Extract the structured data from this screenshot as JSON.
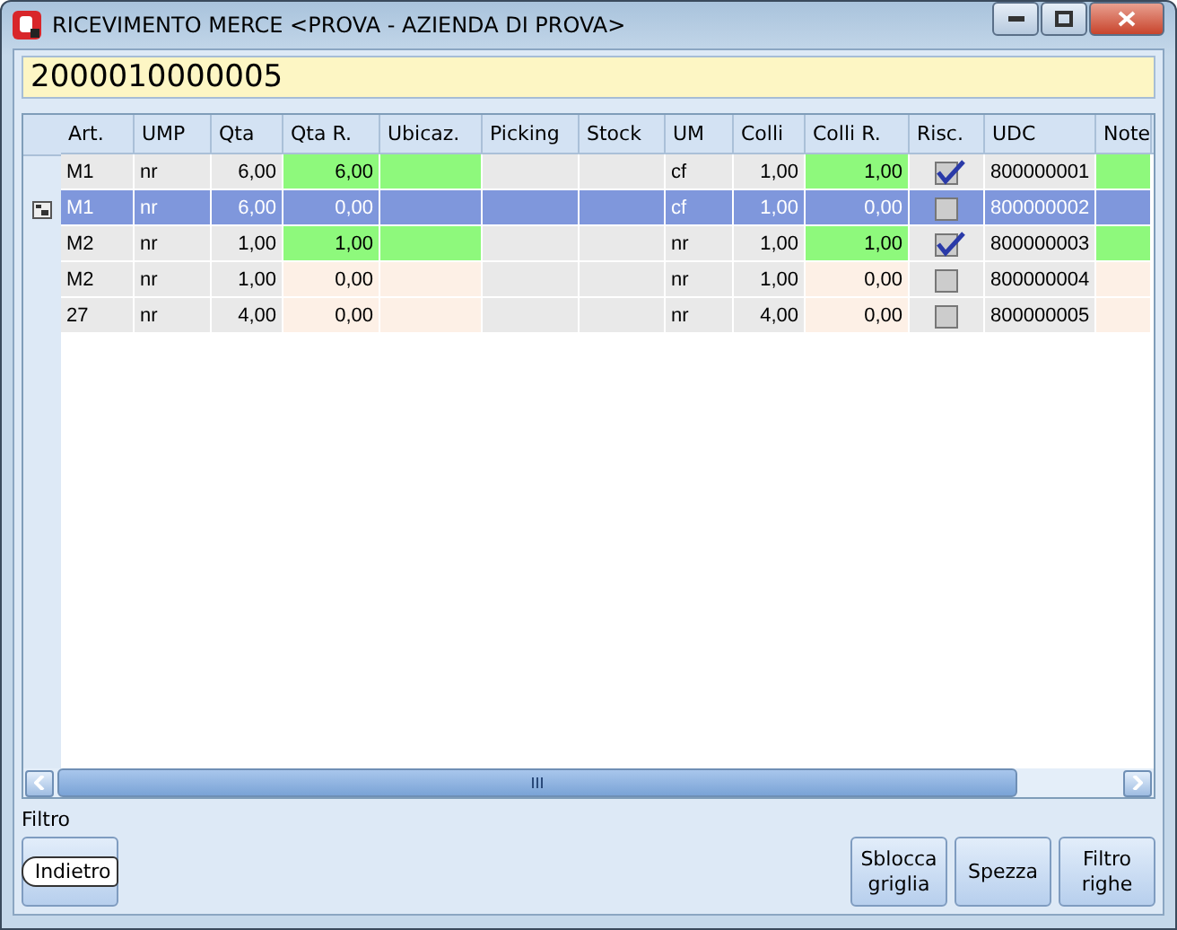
{
  "window": {
    "title": "RICEVIMENTO MERCE <PROVA - AZIENDA DI PROVA>"
  },
  "barcode": {
    "value": "2000010000005"
  },
  "table": {
    "columns": [
      {
        "label": "Art.",
        "kind": "text"
      },
      {
        "label": "UMP",
        "kind": "text"
      },
      {
        "label": "Qta",
        "kind": "number"
      },
      {
        "label": "Qta R.",
        "kind": "entry-number"
      },
      {
        "label": "Ubicaz.",
        "kind": "entry-text"
      },
      {
        "label": "Picking",
        "kind": "text"
      },
      {
        "label": "Stock",
        "kind": "text"
      },
      {
        "label": "UM",
        "kind": "text"
      },
      {
        "label": "Colli",
        "kind": "number"
      },
      {
        "label": "Colli R.",
        "kind": "entry-number"
      },
      {
        "label": "Risc.",
        "kind": "check"
      },
      {
        "label": "UDC",
        "kind": "text"
      },
      {
        "label": "Note",
        "kind": "entry-text"
      }
    ],
    "rows": [
      {
        "selected": false,
        "received": true,
        "checked": true,
        "cells": [
          "M1",
          "nr",
          "6,00",
          "6,00",
          "",
          "",
          "",
          "cf",
          "1,00",
          "1,00",
          "",
          "800000001",
          ""
        ]
      },
      {
        "selected": true,
        "checked": false,
        "cells": [
          "M1",
          "nr",
          "6,00",
          "0,00",
          "",
          "",
          "",
          "cf",
          "1,00",
          "0,00",
          "",
          "800000002",
          ""
        ]
      },
      {
        "selected": false,
        "received": true,
        "checked": true,
        "cells": [
          "M2",
          "nr",
          "1,00",
          "1,00",
          "",
          "",
          "",
          "nr",
          "1,00",
          "1,00",
          "",
          "800000003",
          ""
        ]
      },
      {
        "selected": false,
        "received": false,
        "checked": false,
        "cells": [
          "M2",
          "nr",
          "1,00",
          "0,00",
          "",
          "",
          "",
          "nr",
          "1,00",
          "0,00",
          "",
          "800000004",
          ""
        ]
      },
      {
        "selected": false,
        "received": false,
        "checked": false,
        "cells": [
          "27",
          "nr",
          "4,00",
          "0,00",
          "",
          "",
          "",
          "nr",
          "4,00",
          "0,00",
          "",
          "800000005",
          ""
        ]
      }
    ]
  },
  "filter_label": "Filtro",
  "back_button": "Indietro",
  "buttons": [
    "Sblocca griglia",
    "Spezza",
    "Filtro righe"
  ]
}
